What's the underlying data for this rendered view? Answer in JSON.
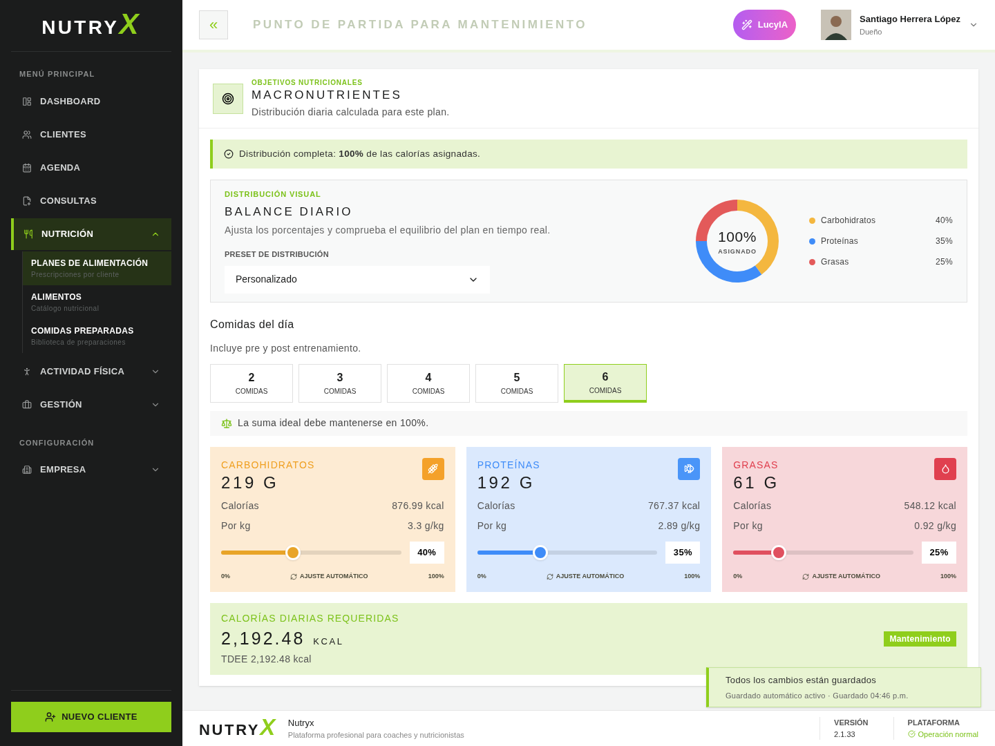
{
  "sidebar": {
    "logo": "NUTRYX",
    "sections": [
      {
        "title": "MENÚ PRINCIPAL",
        "items": [
          {
            "label": "DASHBOARD",
            "selected": false
          },
          {
            "label": "CLIENTES",
            "selected": false
          },
          {
            "label": "AGENDA",
            "selected": false
          },
          {
            "label": "CONSULTAS",
            "selected": false
          },
          {
            "label": "NUTRICIÓN",
            "selected": true,
            "expanded": true,
            "children": [
              {
                "label": "PLANES DE ALIMENTACIÓN",
                "sub": "Prescripciones por cliente",
                "selected": true
              },
              {
                "label": "ALIMENTOS",
                "sub": "Catálogo nutricional",
                "selected": false
              },
              {
                "label": "COMIDAS PREPARADAS",
                "sub": "Biblioteca de preparaciones",
                "selected": false
              }
            ]
          },
          {
            "label": "ACTIVIDAD FÍSICA",
            "selected": false,
            "expanded": false
          },
          {
            "label": "GESTIÓN",
            "selected": false,
            "expanded": false
          }
        ]
      },
      {
        "title": "CONFIGURACIÓN",
        "items": [
          {
            "label": "EMPRESA",
            "selected": false,
            "expanded": false
          }
        ]
      }
    ],
    "new_client_button": "NUEVO CLIENTE"
  },
  "header": {
    "background_title": "PUNTO DE PARTIDA PARA MANTENIMIENTO",
    "collapse_button": "«",
    "assistant_button": "LucyIA",
    "user": {
      "name": "Santiago Herrera López",
      "role": "Dueño"
    }
  },
  "section": {
    "eyebrow": "OBJETIVOS NUTRICIONALES",
    "title": "MACRONUTRIENTES",
    "subtitle": "Distribución diaria calculada para este plan."
  },
  "alert": "Distribución completa: **100%** de las calorías asignadas.",
  "balance": {
    "eyebrow": "DISTRIBUCIÓN VISUAL",
    "title": "BALANCE DIARIO",
    "subtitle": "Ajusta los porcentajes y comprueba el equilibrio del plan en tiempo real.",
    "preset_label": "PRESET DE DISTRIBUCIÓN",
    "preset_value": "Personalizado",
    "center_value": "100%",
    "center_label": "ASIGNADO",
    "chart_data": {
      "type": "donut",
      "categories": [
        "Carbohidratos",
        "Proteínas",
        "Grasas"
      ],
      "series": [
        {
          "values": [
            40,
            35,
            25
          ]
        }
      ],
      "colors": [
        "#f4b73f",
        "#3f8cf8",
        "#e35a5a"
      ]
    },
    "legend_values": [
      "40%",
      "35%",
      "25%"
    ]
  },
  "meals": {
    "title": "Comidas del día",
    "subtitle": "Incluye pre y post entrenamiento.",
    "options": [
      {
        "number": "2",
        "label": "COMIDAS",
        "selected": false
      },
      {
        "number": "3",
        "label": "COMIDAS",
        "selected": false
      },
      {
        "number": "4",
        "label": "COMIDAS",
        "selected": false
      },
      {
        "number": "5",
        "label": "COMIDAS",
        "selected": false
      },
      {
        "number": "6",
        "label": "COMIDAS",
        "selected": true
      }
    ],
    "hint": "La suma ideal debe mantenerse en 100%."
  },
  "macros": [
    {
      "kind": "carbs",
      "name": "CARBOHIDRATOS",
      "grams": "219 G",
      "calories_label": "Calorías",
      "calories": "876.99 kcal",
      "perkg_label": "Por kg",
      "perkg": "3.3 g/kg",
      "level": 0.4,
      "percent": "40%",
      "min": "0%",
      "auto": "AJUSTE AUTOMÁTICO",
      "max": "100%"
    },
    {
      "kind": "protein",
      "name": "PROTEÍNAS",
      "grams": "192 G",
      "calories_label": "Calorías",
      "calories": "767.37 kcal",
      "perkg_label": "Por kg",
      "perkg": "2.89 g/kg",
      "level": 0.35,
      "percent": "35%",
      "min": "0%",
      "auto": "AJUSTE AUTOMÁTICO",
      "max": "100%"
    },
    {
      "kind": "fat",
      "name": "GRASAS",
      "grams": "61 G",
      "calories_label": "Calorías",
      "calories": "548.12 kcal",
      "perkg_label": "Por kg",
      "perkg": "0.92 g/kg",
      "level": 0.25,
      "percent": "25%",
      "min": "0%",
      "auto": "AJUSTE AUTOMÁTICO",
      "max": "100%"
    }
  ],
  "calories": {
    "title": "CALORÍAS DIARIAS REQUERIDAS",
    "value": "2,192.48",
    "unit": "KCAL",
    "tdee": "TDEE 2,192.48 kcal",
    "badge": "Mantenimiento"
  },
  "footer": {
    "logo": "NUTRYX",
    "name": "Nutryx",
    "tagline": "Plataforma profesional para coaches y nutricionistas",
    "version_label": "VERSIÓN",
    "version": "2.1.33",
    "platform_label": "PLATAFORMA",
    "platform_status": "Operación normal"
  },
  "toast": {
    "title": "Todos los cambios están guardados",
    "detail": "Guardado automático activo · Guardado 04:46 p.m."
  }
}
